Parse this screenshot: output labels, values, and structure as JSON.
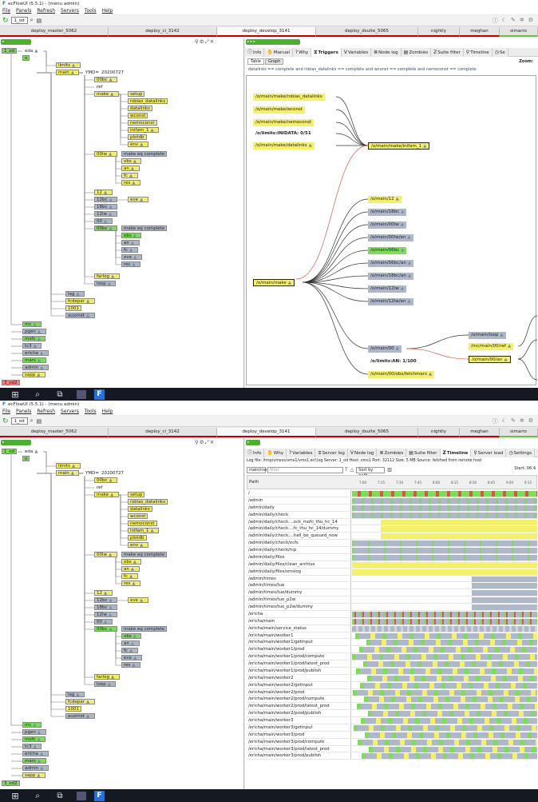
{
  "app": {
    "title": "ecFlowUI (5.5.1) - (menu admin)",
    "menus": [
      "File",
      "Panels",
      "Refresh",
      "Servers",
      "Tools",
      "Help"
    ],
    "server_combo": "1_od",
    "server_tabs": [
      {
        "label": "deploy_master_5062",
        "active": false
      },
      {
        "label": "deploy_ci_3142",
        "active": false
      },
      {
        "label": "deploy_develop_3141",
        "active": false
      },
      {
        "label": "deploy_dsuite_5065",
        "active": false
      },
      {
        "label": "nightly",
        "active": false
      },
      {
        "label": "meghan",
        "active": false
      },
      {
        "label": "simarro",
        "active": false
      }
    ]
  },
  "tree": {
    "nodes": [
      {
        "label": "1_od",
        "state": "active"
      },
      {
        "label": "eda",
        "state": "plain"
      },
      {
        "label": "o",
        "state": "active"
      },
      {
        "label": "limits",
        "state": "complete"
      },
      {
        "label": "main",
        "state": "complete"
      },
      {
        "label": "YMD=",
        "state": "plain"
      },
      {
        "label": "20200727",
        "state": "plain"
      },
      {
        "label": "00bc",
        "state": "complete"
      },
      {
        "label": "ref",
        "state": "plain"
      },
      {
        "label": "make",
        "state": "complete"
      },
      {
        "label": "setup",
        "state": "complete"
      },
      {
        "label": "rsbias_datalinks",
        "state": "complete"
      },
      {
        "label": "datalinks",
        "state": "complete"
      },
      {
        "label": "wconst",
        "state": "complete"
      },
      {
        "label": "nemoconst",
        "state": "complete"
      },
      {
        "label": "inifam_1",
        "state": "complete"
      },
      {
        "label": "plotdb",
        "state": "complete"
      },
      {
        "label": "env",
        "state": "complete"
      },
      {
        "label": "00lw",
        "state": "complete"
      },
      {
        "label": "make eq complete",
        "state": "queued"
      },
      {
        "label": "obs",
        "state": "complete"
      },
      {
        "label": "an",
        "state": "complete"
      },
      {
        "label": "fc",
        "state": "complete"
      },
      {
        "label": "res",
        "state": "complete"
      },
      {
        "label": "12",
        "state": "complete"
      },
      {
        "label": "12bc",
        "state": "queued"
      },
      {
        "label": "eve",
        "state": "complete"
      },
      {
        "label": "18bc",
        "state": "queued"
      },
      {
        "label": "12lw",
        "state": "queued"
      },
      {
        "label": "00",
        "state": "queued"
      },
      {
        "label": "00bc",
        "state": "active"
      },
      {
        "label": "make eq complete",
        "state": "queued"
      },
      {
        "label": "obs",
        "state": "active"
      },
      {
        "label": "an",
        "state": "queued"
      },
      {
        "label": "fc",
        "state": "queued"
      },
      {
        "label": "eve",
        "state": "queued"
      },
      {
        "label": "res",
        "state": "queued"
      },
      {
        "label": "farlog",
        "state": "complete"
      },
      {
        "label": "loop",
        "state": "queued"
      },
      {
        "label": "lag",
        "state": "queued"
      },
      {
        "label": "fcdepar",
        "state": "complete"
      },
      {
        "label": "1001",
        "state": "complete"
      },
      {
        "label": "auxmet",
        "state": "queued"
      },
      {
        "label": "mc",
        "state": "active"
      },
      {
        "label": "pgen",
        "state": "queued"
      },
      {
        "label": "mofc",
        "state": "active"
      },
      {
        "label": "tc3",
        "state": "queued"
      },
      {
        "label": "ericha",
        "state": "queued"
      },
      {
        "label": "mars",
        "state": "active"
      },
      {
        "label": "admin",
        "state": "queued"
      },
      {
        "label": "sapp",
        "state": "complete"
      }
    ],
    "top_extra": {
      "label": "3_od2",
      "state": "aborted"
    },
    "bottom_extra": {
      "label": "3_od2",
      "state": "active"
    },
    "trigger_label": "make eq complete"
  },
  "triggers_panel": {
    "tabs": [
      "Info",
      "Manual",
      "Why",
      "Triggers",
      "Variables",
      "Node log",
      "Zombies",
      "Suite filter",
      "Timeline",
      "Se"
    ],
    "subtabs": [
      "Table",
      "Graph"
    ],
    "zoom_label": "Zoom:",
    "expression": "datalinks == complete and rsbias_datalinks == complete and wconst == complete and nemoconst == complete",
    "graph_nodes": [
      {
        "label": "/o/main/make/rsbias_datalinks",
        "state": "complete"
      },
      {
        "label": "/o/main/make/wconst",
        "state": "complete"
      },
      {
        "label": "/o/main/make/nemoconst",
        "state": "complete"
      },
      {
        "label": "/o/limits:INIDATA: 0/51",
        "state": "plain"
      },
      {
        "label": "/o/main/make/datalinks",
        "state": "complete"
      },
      {
        "label": "/o/main/make/inifam_1",
        "state": "complete"
      },
      {
        "label": "/o/main/make",
        "state": "complete"
      },
      {
        "label": "/o/main/12",
        "state": "complete"
      },
      {
        "label": "/o/main/18bc",
        "state": "queued"
      },
      {
        "label": "/o/main/00lw",
        "state": "queued"
      },
      {
        "label": "/o/main/00lw/an",
        "state": "queued"
      },
      {
        "label": "/o/main/06bc",
        "state": "active"
      },
      {
        "label": "/o/main/06bc/an",
        "state": "queued"
      },
      {
        "label": "/o/main/18bc/an",
        "state": "queued"
      },
      {
        "label": "/o/main/12lw",
        "state": "queued"
      },
      {
        "label": "/o/main/12lw/an",
        "state": "queued"
      },
      {
        "label": "/o/main/loop",
        "state": "queued"
      },
      {
        "label": "/mc/main/00/ref",
        "state": "complete"
      },
      {
        "label": "/o/main/00",
        "state": "queued"
      },
      {
        "label": "/o/main/00/an",
        "state": "complete"
      },
      {
        "label": "/o/limits:AN: 1/100",
        "state": "plain"
      },
      {
        "label": "/o/main/00/obs/fetchmars",
        "state": "complete"
      }
    ]
  },
  "timeline_panel": {
    "tabs": [
      "Info",
      "Why",
      "Variables",
      "Server log",
      "Node log",
      "Zombies",
      "Suite filter",
      "Timeline",
      "Server load",
      "Settings"
    ],
    "logbar": "Log file: /tmp/vmsxs/vms1/vms1.ecf.log  Server: 1_od  Host: vms1  Port: 32112  Size: 5 MB  Source: fetched from remote host",
    "combo": "main/nss",
    "filter_placeholder": "filter",
    "sort_label": "Sort by path",
    "start_label": "Start: 06:4",
    "path_header": "Path",
    "ticks": [
      "7:00",
      "7:15",
      "7:30",
      "7:45",
      "8:00",
      "8:15",
      "8:30",
      "8:45",
      "9:00",
      "9:15"
    ],
    "rows": [
      "/",
      "/admin",
      "/admin/daily",
      "/admin/daily/check",
      "/admin/daily/check....eck_mofc_thu_hc_14",
      "/admin/daily/check....fc_thu_hc_14/dummy",
      "/admin/daily/check....hall_be_queued_now",
      "/admin/daily/check/ecfs",
      "/admin/daily/check/rcp",
      "/admin/daily/files",
      "/admin/daily/files/clean_archive",
      "/admin/daily/files/smslog",
      "/admin/times",
      "/admin/times/tue",
      "/admin/times/tue/dummy",
      "/admin/times/tue_p2w",
      "/admin/times/tue_p2w/dummy",
      "/ericha",
      "/ericha/main",
      "/ericha/main/service_status",
      "/ericha/main/worker1",
      "/ericha/main/worker1/getinput",
      "/ericha/main/worker1/prod",
      "/ericha/main/worker1/prod/compute",
      "/ericha/main/worker1/prod/latest_prod",
      "/ericha/main/worker1/prod/publish",
      "/ericha/main/worker2",
      "/ericha/main/worker2/getinput",
      "/ericha/main/worker2/prod",
      "/ericha/main/worker2/prod/compute",
      "/ericha/main/worker2/prod/latest_prod",
      "/ericha/main/worker2/prod/publish",
      "/ericha/main/worker3",
      "/ericha/main/worker3/getinput",
      "/ericha/main/worker3/prod",
      "/ericha/main/worker3/prod/compute",
      "/ericha/main/worker3/prod/latest_prod",
      "/ericha/main/worker3/prod/publish"
    ]
  },
  "colors": {
    "complete": "#f5f06a",
    "queued": "#aeb8c9",
    "active": "#7ddc5a",
    "aborted": "#f08080",
    "accent": "#2a6fd6"
  }
}
